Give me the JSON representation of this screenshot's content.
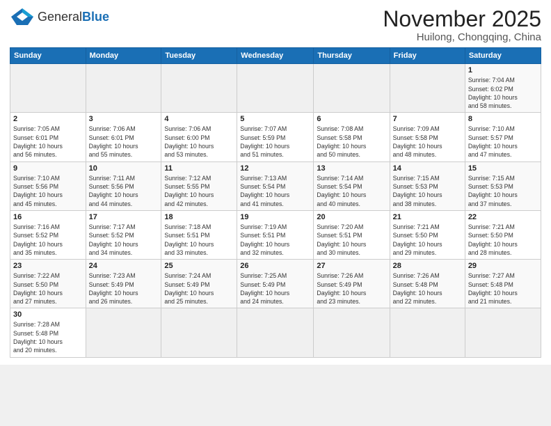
{
  "header": {
    "logo_general": "General",
    "logo_blue": "Blue",
    "month_title": "November 2025",
    "location": "Huilong, Chongqing, China"
  },
  "weekdays": [
    "Sunday",
    "Monday",
    "Tuesday",
    "Wednesday",
    "Thursday",
    "Friday",
    "Saturday"
  ],
  "weeks": [
    [
      {
        "day": "",
        "info": ""
      },
      {
        "day": "",
        "info": ""
      },
      {
        "day": "",
        "info": ""
      },
      {
        "day": "",
        "info": ""
      },
      {
        "day": "",
        "info": ""
      },
      {
        "day": "",
        "info": ""
      },
      {
        "day": "1",
        "info": "Sunrise: 7:04 AM\nSunset: 6:02 PM\nDaylight: 10 hours\nand 58 minutes."
      }
    ],
    [
      {
        "day": "2",
        "info": "Sunrise: 7:05 AM\nSunset: 6:01 PM\nDaylight: 10 hours\nand 56 minutes."
      },
      {
        "day": "3",
        "info": "Sunrise: 7:06 AM\nSunset: 6:01 PM\nDaylight: 10 hours\nand 55 minutes."
      },
      {
        "day": "4",
        "info": "Sunrise: 7:06 AM\nSunset: 6:00 PM\nDaylight: 10 hours\nand 53 minutes."
      },
      {
        "day": "5",
        "info": "Sunrise: 7:07 AM\nSunset: 5:59 PM\nDaylight: 10 hours\nand 51 minutes."
      },
      {
        "day": "6",
        "info": "Sunrise: 7:08 AM\nSunset: 5:58 PM\nDaylight: 10 hours\nand 50 minutes."
      },
      {
        "day": "7",
        "info": "Sunrise: 7:09 AM\nSunset: 5:58 PM\nDaylight: 10 hours\nand 48 minutes."
      },
      {
        "day": "8",
        "info": "Sunrise: 7:10 AM\nSunset: 5:57 PM\nDaylight: 10 hours\nand 47 minutes."
      }
    ],
    [
      {
        "day": "9",
        "info": "Sunrise: 7:10 AM\nSunset: 5:56 PM\nDaylight: 10 hours\nand 45 minutes."
      },
      {
        "day": "10",
        "info": "Sunrise: 7:11 AM\nSunset: 5:56 PM\nDaylight: 10 hours\nand 44 minutes."
      },
      {
        "day": "11",
        "info": "Sunrise: 7:12 AM\nSunset: 5:55 PM\nDaylight: 10 hours\nand 42 minutes."
      },
      {
        "day": "12",
        "info": "Sunrise: 7:13 AM\nSunset: 5:54 PM\nDaylight: 10 hours\nand 41 minutes."
      },
      {
        "day": "13",
        "info": "Sunrise: 7:14 AM\nSunset: 5:54 PM\nDaylight: 10 hours\nand 40 minutes."
      },
      {
        "day": "14",
        "info": "Sunrise: 7:15 AM\nSunset: 5:53 PM\nDaylight: 10 hours\nand 38 minutes."
      },
      {
        "day": "15",
        "info": "Sunrise: 7:15 AM\nSunset: 5:53 PM\nDaylight: 10 hours\nand 37 minutes."
      }
    ],
    [
      {
        "day": "16",
        "info": "Sunrise: 7:16 AM\nSunset: 5:52 PM\nDaylight: 10 hours\nand 35 minutes."
      },
      {
        "day": "17",
        "info": "Sunrise: 7:17 AM\nSunset: 5:52 PM\nDaylight: 10 hours\nand 34 minutes."
      },
      {
        "day": "18",
        "info": "Sunrise: 7:18 AM\nSunset: 5:51 PM\nDaylight: 10 hours\nand 33 minutes."
      },
      {
        "day": "19",
        "info": "Sunrise: 7:19 AM\nSunset: 5:51 PM\nDaylight: 10 hours\nand 32 minutes."
      },
      {
        "day": "20",
        "info": "Sunrise: 7:20 AM\nSunset: 5:51 PM\nDaylight: 10 hours\nand 30 minutes."
      },
      {
        "day": "21",
        "info": "Sunrise: 7:21 AM\nSunset: 5:50 PM\nDaylight: 10 hours\nand 29 minutes."
      },
      {
        "day": "22",
        "info": "Sunrise: 7:21 AM\nSunset: 5:50 PM\nDaylight: 10 hours\nand 28 minutes."
      }
    ],
    [
      {
        "day": "23",
        "info": "Sunrise: 7:22 AM\nSunset: 5:50 PM\nDaylight: 10 hours\nand 27 minutes."
      },
      {
        "day": "24",
        "info": "Sunrise: 7:23 AM\nSunset: 5:49 PM\nDaylight: 10 hours\nand 26 minutes."
      },
      {
        "day": "25",
        "info": "Sunrise: 7:24 AM\nSunset: 5:49 PM\nDaylight: 10 hours\nand 25 minutes."
      },
      {
        "day": "26",
        "info": "Sunrise: 7:25 AM\nSunset: 5:49 PM\nDaylight: 10 hours\nand 24 minutes."
      },
      {
        "day": "27",
        "info": "Sunrise: 7:26 AM\nSunset: 5:49 PM\nDaylight: 10 hours\nand 23 minutes."
      },
      {
        "day": "28",
        "info": "Sunrise: 7:26 AM\nSunset: 5:48 PM\nDaylight: 10 hours\nand 22 minutes."
      },
      {
        "day": "29",
        "info": "Sunrise: 7:27 AM\nSunset: 5:48 PM\nDaylight: 10 hours\nand 21 minutes."
      }
    ],
    [
      {
        "day": "30",
        "info": "Sunrise: 7:28 AM\nSunset: 5:48 PM\nDaylight: 10 hours\nand 20 minutes."
      },
      {
        "day": "",
        "info": ""
      },
      {
        "day": "",
        "info": ""
      },
      {
        "day": "",
        "info": ""
      },
      {
        "day": "",
        "info": ""
      },
      {
        "day": "",
        "info": ""
      },
      {
        "day": "",
        "info": ""
      }
    ]
  ]
}
